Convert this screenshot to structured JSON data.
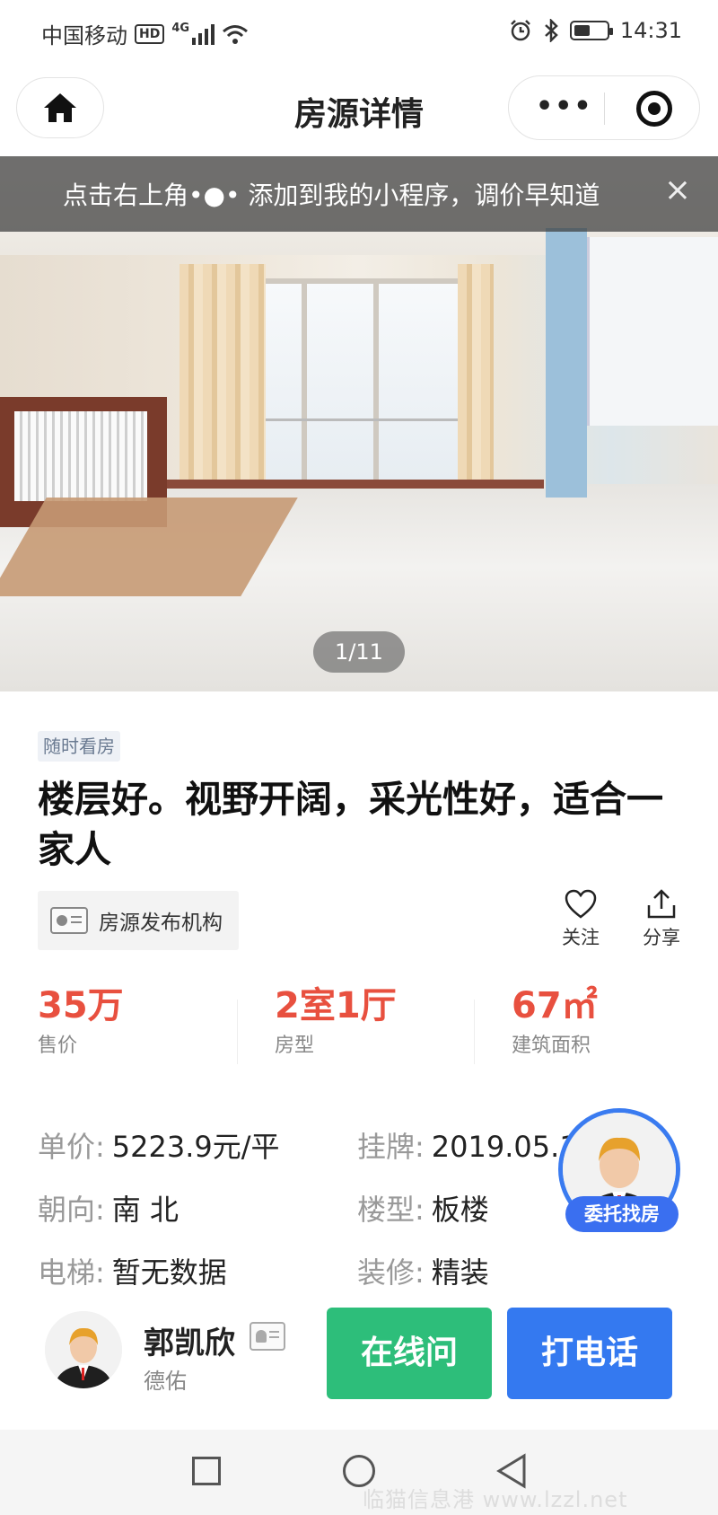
{
  "status_bar": {
    "carrier": "中国移动",
    "hd": "HD",
    "network": "4G",
    "time": "14:31",
    "battery_level": 0.5
  },
  "navbar": {
    "title": "房源详情",
    "more": "•••"
  },
  "notice": {
    "text": "点击右上角•●• 添加到我的小程序，调价早知道",
    "close": "×"
  },
  "gallery": {
    "counter": "1/11"
  },
  "listing": {
    "tag": "随时看房",
    "title": "楼层好。视野开阔，采光性好，适合一家人",
    "org_label": "房源发布机构",
    "follow_label": "关注",
    "share_label": "分享"
  },
  "stats": [
    {
      "value": "35万",
      "label": "售价"
    },
    {
      "value": "2室1厅",
      "label": "房型"
    },
    {
      "value": "67㎡",
      "label": "建筑面积"
    }
  ],
  "details": {
    "unit_price": {
      "label": "单价:",
      "value": "5223.9元/平"
    },
    "listed": {
      "label": "挂牌:",
      "value": "2019.05.1"
    },
    "orientation": {
      "label": "朝向:",
      "value": "南 北"
    },
    "building_type": {
      "label": "楼型:",
      "value": "板楼"
    },
    "elevator": {
      "label": "电梯:",
      "value": "暂无数据"
    },
    "decoration": {
      "label": "装修:",
      "value": "精装"
    }
  },
  "float": {
    "label": "委托找房"
  },
  "agent": {
    "name": "郭凯欣",
    "company": "德佑",
    "chat_label": "在线问",
    "call_label": "打电话"
  },
  "watermark": "临猫信息港 www.lzzl.net",
  "colors": {
    "price_red": "#e8503f",
    "chat_green": "#2dbe7a",
    "call_blue": "#3479f0"
  }
}
